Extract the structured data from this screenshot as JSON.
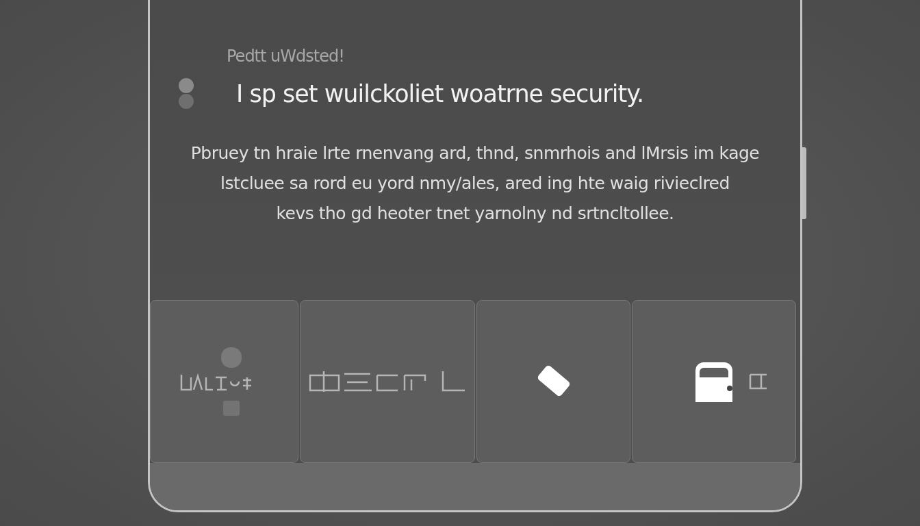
{
  "screen": {
    "eyebrow": "Pedtt uWdsted!",
    "title": "I sp set wuilckoliet woatrne security.",
    "body": "Pbruey tn hraie lrte rnenvang ard, thnd, snmrhois and lMrsis im kage\nlstcluee sa rord eu yord nmy/ales, ared ing hte waig rivieclred\nkevs tho gd heoter tnet yarnolny nd srtncltollee."
  },
  "tiles": [
    {
      "kind": "glyphs"
    },
    {
      "kind": "marks"
    },
    {
      "kind": "tag"
    },
    {
      "kind": "lock"
    }
  ]
}
